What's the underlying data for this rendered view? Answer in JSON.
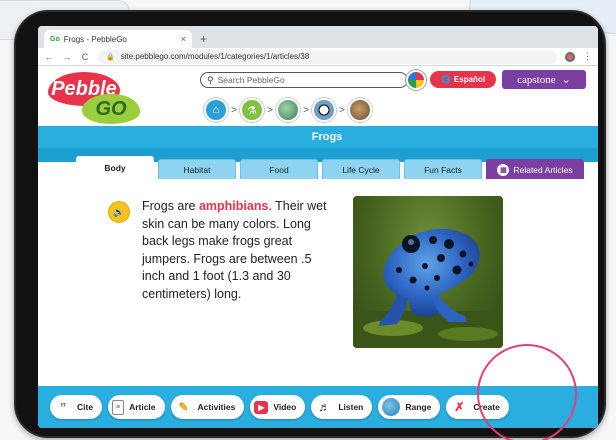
{
  "browser": {
    "tab_title": "Frogs - PebbleGo",
    "tab_favicon": "Go",
    "tab_close": "×",
    "new_tab": "+",
    "back": "←",
    "forward": "→",
    "reload": "C",
    "url": "site.pebblego.com/modules/1/categories/1/articles/38",
    "menu": "⋮"
  },
  "header": {
    "logo_top": "Pebble",
    "logo_bottom": "GO",
    "search_placeholder": "Search PebbleGo",
    "espanol_label": "Español",
    "capstone_label": "capstone",
    "capstone_chevron": "⌄",
    "breadcrumb_separator": ">",
    "breadcrumb_icons": [
      "home-icon",
      "science-icon",
      "animals-icon",
      "panda-icon",
      "frogs-icon"
    ]
  },
  "page": {
    "title": "Frogs"
  },
  "tabs": [
    {
      "label": "Body"
    },
    {
      "label": "Habitat"
    },
    {
      "label": "Food"
    },
    {
      "label": "Life Cycle"
    },
    {
      "label": "Fun Facts"
    },
    {
      "label": "Related Articles"
    }
  ],
  "article": {
    "text_before": "Frogs are ",
    "keyword": "amphibians",
    "text_after": ". Their wet skin can be many colors. Long back legs make frogs great jumpers. Frogs are between .5 inch and 1 foot (1.3 and 30 centimeters) long.",
    "image_subject": "blue poison dart frog"
  },
  "toolbar": {
    "items": [
      {
        "label": "Cite",
        "icon": "quote-icon"
      },
      {
        "label": "Article",
        "icon": "document-icon"
      },
      {
        "label": "Activities",
        "icon": "pencil-icon"
      },
      {
        "label": "Video",
        "icon": "play-icon"
      },
      {
        "label": "Listen",
        "icon": "headphones-icon"
      },
      {
        "label": "Range",
        "icon": "globe-icon"
      },
      {
        "label": "Create",
        "icon": "create-icon"
      }
    ]
  },
  "colors": {
    "brand_red": "#e8334a",
    "brand_green": "#9ccd3a",
    "band_blue": "#2aaee0",
    "purple": "#7a3fa0",
    "annotation_pink": "#e0407a"
  }
}
